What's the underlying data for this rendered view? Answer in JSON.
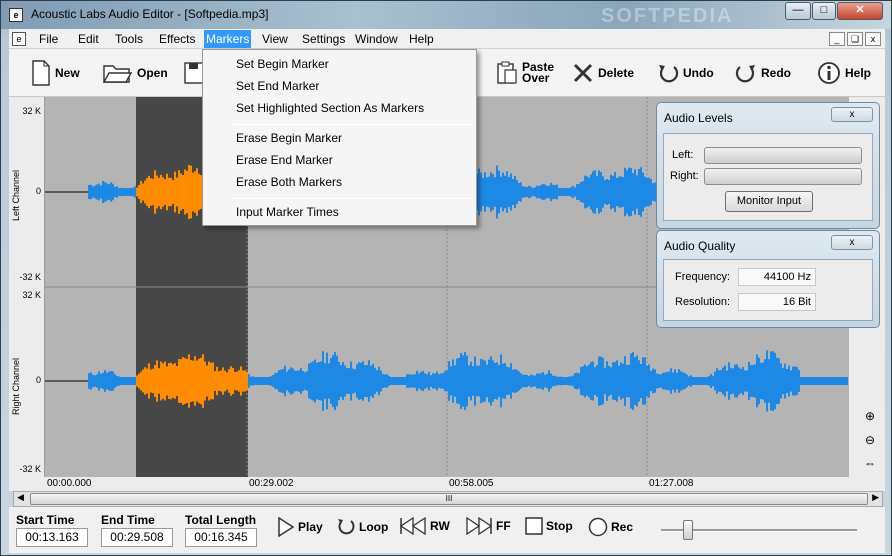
{
  "window": {
    "title": "Acoustic Labs Audio Editor - [Softpedia.mp3]",
    "app_icon": "document-icon",
    "watermark": "SOFTPEDIA"
  },
  "menubar": {
    "items": [
      "File",
      "Edit",
      "Tools",
      "Effects",
      "Markers",
      "View",
      "Settings",
      "Window",
      "Help"
    ],
    "open_menu": "Markers",
    "effects_overlay": "softpedia"
  },
  "toolbar": {
    "new": "New",
    "open": "Open",
    "paste_over_1": "Paste",
    "paste_over_2": "Over",
    "delete": "Delete",
    "undo": "Undo",
    "redo": "Redo",
    "help": "Help"
  },
  "markers_menu": {
    "items": [
      "Set Begin Marker",
      "Set End Marker",
      "Set Highlighted Section As Markers",
      "Erase Begin Marker",
      "Erase End Marker",
      "Erase Both Markers",
      "Input Marker Times"
    ]
  },
  "waveform": {
    "left_channel": "Left Channel",
    "right_channel": "Right Channel",
    "scale_top": "32 K",
    "scale_mid": "0",
    "scale_bottom": "-32 K",
    "colors": {
      "wave": "#1e88e5",
      "selection": "#ff8c00",
      "highlight_bg": "#474747",
      "bg": "#b4b4b4"
    }
  },
  "timeline": {
    "labels": [
      "00:00.000",
      "00:29.002",
      "00:58.005",
      "01:27.008"
    ]
  },
  "audio_levels": {
    "title": "Audio Levels",
    "close": "x",
    "left": "Left:",
    "right": "Right:",
    "monitor": "Monitor Input"
  },
  "audio_quality": {
    "title": "Audio Quality",
    "close": "x",
    "frequency_label": "Frequency:",
    "frequency": "44100 Hz",
    "resolution_label": "Resolution:",
    "resolution": "16 Bit"
  },
  "transport": {
    "start_label": "Start Time",
    "start": "00:13.163",
    "end_label": "End Time",
    "end": "00:29.508",
    "total_label": "Total Length",
    "total": "00:16.345",
    "play": "Play",
    "loop": "Loop",
    "rw": "RW",
    "ff": "FF",
    "stop": "Stop",
    "rec": "Rec"
  },
  "scroll": {
    "thumb_grip": "III"
  }
}
